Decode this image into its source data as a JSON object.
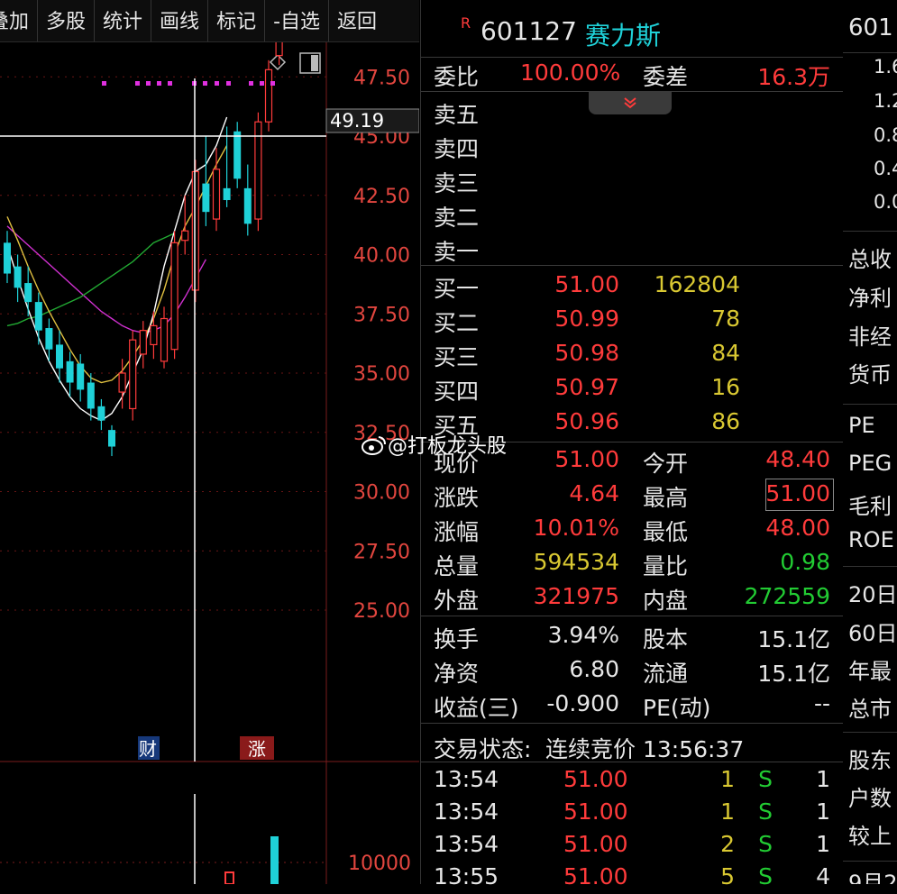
{
  "toolbar": {
    "items": [
      "叠加",
      "多股",
      "统计",
      "画线",
      "标记",
      "-自选",
      "返回"
    ]
  },
  "chart": {
    "price_label": "49.19",
    "ticks": [
      "47.50",
      "45.00",
      "42.50",
      "40.00",
      "37.50",
      "35.00",
      "32.50",
      "30.00",
      "27.50",
      "25.00"
    ],
    "volume_tick": "10000",
    "marker_cai": "财",
    "marker_zhang": "涨"
  },
  "chart_data": {
    "type": "candlestick",
    "candles": [
      {
        "o": 40.5,
        "c": 39.2,
        "h": 41.0,
        "l": 38.8
      },
      {
        "o": 39.5,
        "c": 38.6,
        "h": 40.0,
        "l": 38.0
      },
      {
        "o": 38.8,
        "c": 38.0,
        "h": 39.5,
        "l": 37.4
      },
      {
        "o": 38.0,
        "c": 36.8,
        "h": 38.4,
        "l": 36.2
      },
      {
        "o": 36.9,
        "c": 36.0,
        "h": 37.3,
        "l": 35.5
      },
      {
        "o": 36.2,
        "c": 35.2,
        "h": 36.8,
        "l": 34.6
      },
      {
        "o": 35.5,
        "c": 34.6,
        "h": 35.9,
        "l": 34.0
      },
      {
        "o": 35.4,
        "c": 34.3,
        "h": 35.8,
        "l": 33.8
      },
      {
        "o": 34.6,
        "c": 33.5,
        "h": 35.0,
        "l": 33.0
      },
      {
        "o": 33.6,
        "c": 33.0,
        "h": 33.9,
        "l": 32.6
      },
      {
        "o": 32.6,
        "c": 31.9,
        "h": 32.8,
        "l": 31.5
      },
      {
        "o": 34.2,
        "c": 35.0,
        "h": 35.6,
        "l": 33.5
      },
      {
        "o": 33.5,
        "c": 36.4,
        "h": 36.8,
        "l": 33.0
      },
      {
        "o": 35.8,
        "c": 36.8,
        "h": 37.2,
        "l": 35.2
      },
      {
        "o": 36.2,
        "c": 37.0,
        "h": 37.6,
        "l": 35.6
      },
      {
        "o": 35.5,
        "c": 37.3,
        "h": 37.8,
        "l": 35.2
      },
      {
        "o": 36.0,
        "c": 40.5,
        "h": 41.0,
        "l": 35.6
      },
      {
        "o": 40.6,
        "c": 41.0,
        "h": 42.5,
        "l": 40.0
      },
      {
        "o": 38.5,
        "c": 43.5,
        "h": 44.0,
        "l": 38.0
      },
      {
        "o": 43.0,
        "c": 41.8,
        "h": 45.0,
        "l": 41.2
      },
      {
        "o": 41.5,
        "c": 43.6,
        "h": 44.5,
        "l": 41.0
      },
      {
        "o": 42.8,
        "c": 42.3,
        "h": 45.4,
        "l": 42.0
      },
      {
        "o": 45.2,
        "c": 43.2,
        "h": 45.6,
        "l": 42.8
      },
      {
        "o": 42.8,
        "c": 41.3,
        "h": 43.8,
        "l": 40.8
      },
      {
        "o": 41.5,
        "c": 45.6,
        "h": 46.0,
        "l": 41.0
      },
      {
        "o": 45.6,
        "c": 47.8,
        "h": 48.2,
        "l": 45.2
      },
      {
        "o": 48.4,
        "c": 51.0,
        "h": 51.0,
        "l": 48.0
      }
    ],
    "ma_white": [
      40.4,
      39.0,
      37.7,
      36.5,
      35.5,
      34.7,
      34.0,
      33.5,
      33.2,
      33.0,
      33.3,
      34.0,
      35.0,
      36.0,
      37.5,
      39.5,
      41.0,
      42.5,
      43.5,
      43.8,
      44.6,
      45.8
    ],
    "ma_yellow": [
      41.6,
      40.6,
      39.5,
      38.5,
      37.6,
      36.8,
      36.0,
      35.3,
      34.8,
      34.6,
      34.7,
      35.1,
      35.7,
      36.4,
      37.3,
      38.5,
      40.0,
      41.2,
      42.0,
      42.9,
      43.8,
      44.6
    ],
    "ma_green": [
      37.0,
      37.1,
      37.3,
      37.4,
      37.6,
      37.8,
      38.0,
      38.2,
      38.5,
      38.8,
      39.1,
      39.4,
      39.7,
      40.1,
      40.5,
      40.7,
      40.9
    ],
    "ma_magenta": [
      41.2,
      40.8,
      40.4,
      40.0,
      39.6,
      39.2,
      38.8,
      38.4,
      38.0,
      37.6,
      37.3,
      37.0,
      36.8,
      36.7,
      36.8,
      37.0,
      37.5,
      38.2,
      39.0,
      39.8
    ],
    "y_range": [
      25.0,
      51.0
    ]
  },
  "quote": {
    "code": "601127",
    "name": "赛力斯",
    "r_badge": "R",
    "weibi_label": "委比",
    "weibi": "100.00%",
    "weicha_label": "委差",
    "weicha": "16.3万",
    "sell": [
      {
        "label": "卖五"
      },
      {
        "label": "卖四"
      },
      {
        "label": "卖三"
      },
      {
        "label": "卖二"
      },
      {
        "label": "卖一"
      }
    ],
    "buy": [
      {
        "label": "买一",
        "price": "51.00",
        "vol": "162804"
      },
      {
        "label": "买二",
        "price": "50.99",
        "vol": "78"
      },
      {
        "label": "买三",
        "price": "50.98",
        "vol": "84"
      },
      {
        "label": "买四",
        "price": "50.97",
        "vol": "16"
      },
      {
        "label": "买五",
        "price": "50.96",
        "vol": "86"
      }
    ],
    "stats": [
      {
        "l1": "现价",
        "v1": "51.00",
        "l2": "今开",
        "v2": "48.40"
      },
      {
        "l1": "涨跌",
        "v1": "4.64",
        "l2": "最高",
        "v2": "51.00"
      },
      {
        "l1": "涨幅",
        "v1": "10.01%",
        "l2": "最低",
        "v2": "48.00"
      },
      {
        "l1": "总量",
        "v1": "594534",
        "l2": "量比",
        "v2": "0.98"
      },
      {
        "l1": "外盘",
        "v1": "321975",
        "l2": "内盘",
        "v2": "272559"
      }
    ],
    "stats2": [
      {
        "l1": "换手",
        "v1": "3.94%",
        "l2": "股本",
        "v2": "15.1亿"
      },
      {
        "l1": "净资",
        "v1": "6.80",
        "l2": "流通",
        "v2": "15.1亿"
      },
      {
        "l1": "收益(三)",
        "v1": "-0.900",
        "l2": "PE(动)",
        "v2": "--"
      }
    ],
    "status_label": "交易状态:",
    "status": "连续竞价 13:56:37",
    "ticks": [
      {
        "time": "13:54",
        "price": "51.00",
        "vol": "1",
        "bs": "S",
        "n": "1"
      },
      {
        "time": "13:54",
        "price": "51.00",
        "vol": "1",
        "bs": "S",
        "n": "1"
      },
      {
        "time": "13:54",
        "price": "51.00",
        "vol": "2",
        "bs": "S",
        "n": "1"
      },
      {
        "time": "13:55",
        "price": "51.00",
        "vol": "5",
        "bs": "S",
        "n": "4"
      }
    ]
  },
  "right_panel": {
    "code": "601",
    "scale": [
      "1.6",
      "1.2",
      "0.8",
      "0.4",
      "0.0"
    ],
    "labels_a": [
      "总收",
      "净利",
      "非经",
      "货币"
    ],
    "labels_b": [
      "PE",
      "PEG",
      "毛利",
      "ROE"
    ],
    "labels_c": [
      "20日",
      "60日",
      "年最",
      "总市"
    ],
    "labels_d": [
      "股东",
      "户数",
      "较上"
    ],
    "bottom": "9月2"
  },
  "watermark": "@打板龙头股"
}
